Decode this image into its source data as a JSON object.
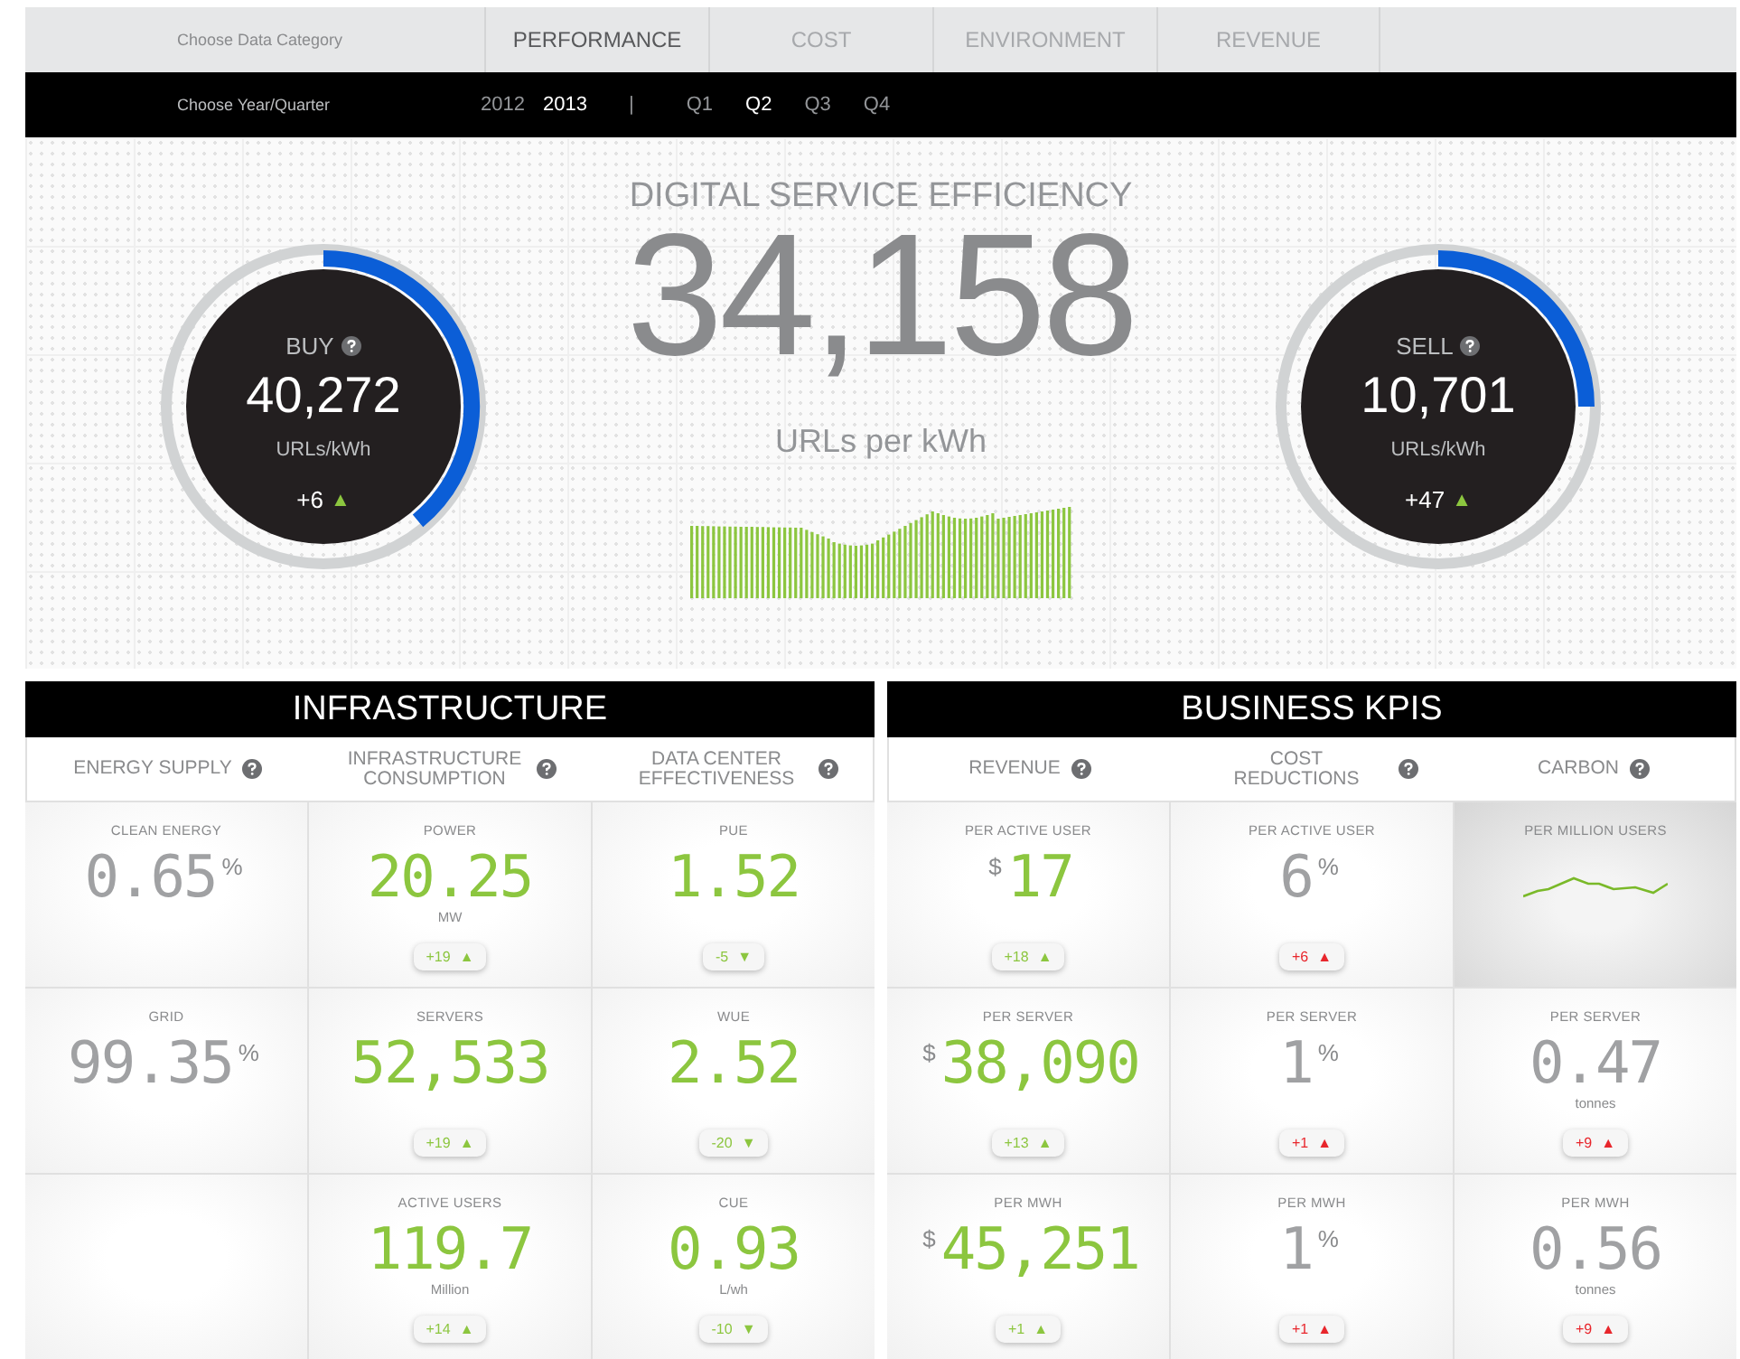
{
  "category_bar": {
    "label": "Choose Data Category",
    "tabs": [
      {
        "label": "PERFORMANCE",
        "selected": true
      },
      {
        "label": "COST",
        "selected": false
      },
      {
        "label": "ENVIRONMENT",
        "selected": false
      },
      {
        "label": "REVENUE",
        "selected": false
      }
    ]
  },
  "period_bar": {
    "label": "Choose Year/Quarter",
    "years": [
      {
        "label": "2012",
        "selected": false
      },
      {
        "label": "2013",
        "selected": true
      }
    ],
    "separator": "|",
    "quarters": [
      {
        "label": "Q1",
        "selected": false
      },
      {
        "label": "Q2",
        "selected": true
      },
      {
        "label": "Q3",
        "selected": false
      },
      {
        "label": "Q4",
        "selected": false
      }
    ]
  },
  "hero": {
    "title": "DIGITAL SERVICE EFFICIENCY",
    "value": "34,158",
    "chart_label": "URLs per kWh",
    "gauges": [
      {
        "label": "BUY",
        "value": "40,272",
        "unit": "URLs/kWh",
        "change": "+6",
        "arrow": "▲"
      },
      {
        "label": "SELL",
        "value": "10,701",
        "unit": "URLs/kWh",
        "change": "+47",
        "arrow": "▲"
      }
    ]
  },
  "panels": [
    {
      "title": "INFRASTRUCTURE",
      "columns": [
        {
          "label": "ENERGY SUPPLY"
        },
        {
          "label": "INFRASTRUCTURE CONSUMPTION"
        },
        {
          "label": "DATA CENTER EFFECTIVENESS"
        }
      ],
      "rows": [
        [
          {
            "kind": "metric",
            "label": "CLEAN ENERGY",
            "value": "0.65",
            "suffix": "%",
            "highlight": false
          },
          {
            "kind": "metric",
            "label": "POWER",
            "value": "20.25",
            "unit": "MW",
            "highlight": true,
            "change": {
              "text": "+19",
              "arrow": "▲",
              "favorable": true
            }
          },
          {
            "kind": "metric",
            "label": "PUE",
            "value": "1.52",
            "highlight": true,
            "change": {
              "text": "-5",
              "arrow": "▼",
              "favorable": true
            }
          }
        ],
        [
          {
            "kind": "metric",
            "label": "GRID",
            "value": "99.35",
            "suffix": "%",
            "highlight": false
          },
          {
            "kind": "metric",
            "label": "SERVERS",
            "value": "52,533",
            "highlight": true,
            "change": {
              "text": "+19",
              "arrow": "▲",
              "favorable": true
            }
          },
          {
            "kind": "metric",
            "label": "WUE",
            "value": "2.52",
            "highlight": true,
            "change": {
              "text": "-20",
              "arrow": "▼",
              "favorable": true
            }
          }
        ],
        [
          {
            "kind": "empty"
          },
          {
            "kind": "metric",
            "label": "ACTIVE USERS",
            "value": "119.7",
            "unit": "Million",
            "highlight": true,
            "change": {
              "text": "+14",
              "arrow": "▲",
              "favorable": true
            }
          },
          {
            "kind": "metric",
            "label": "CUE",
            "value": "0.93",
            "unit": "L/wh",
            "highlight": true,
            "change": {
              "text": "-10",
              "arrow": "▼",
              "favorable": true
            }
          }
        ]
      ]
    },
    {
      "title": "BUSINESS KPIS",
      "columns": [
        {
          "label": "REVENUE"
        },
        {
          "label": "COST REDUCTIONS"
        },
        {
          "label": "CARBON"
        }
      ],
      "rows": [
        [
          {
            "kind": "metric",
            "label": "PER ACTIVE USER",
            "prefix": "$",
            "value": "17",
            "highlight": true,
            "change": {
              "text": "+18",
              "arrow": "▲",
              "favorable": true
            }
          },
          {
            "kind": "metric",
            "label": "PER ACTIVE USER",
            "value": "6",
            "suffix": "%",
            "highlight": false,
            "change": {
              "text": "+6",
              "arrow": "▲",
              "favorable": false
            }
          },
          {
            "kind": "sparkline",
            "label": "PER MILLION USERS"
          }
        ],
        [
          {
            "kind": "metric",
            "label": "PER SERVER",
            "prefix": "$",
            "value": "38,090",
            "highlight": true,
            "change": {
              "text": "+13",
              "arrow": "▲",
              "favorable": true
            }
          },
          {
            "kind": "metric",
            "label": "PER SERVER",
            "value": "1",
            "suffix": "%",
            "highlight": false,
            "change": {
              "text": "+1",
              "arrow": "▲",
              "favorable": false
            }
          },
          {
            "kind": "metric",
            "label": "PER SERVER",
            "value": "0.47",
            "unit": "tonnes",
            "highlight": false,
            "change": {
              "text": "+9",
              "arrow": "▲",
              "favorable": false
            }
          }
        ],
        [
          {
            "kind": "metric",
            "label": "PER MWH",
            "prefix": "$",
            "value": "45,251",
            "highlight": true,
            "change": {
              "text": "+1",
              "arrow": "▲",
              "favorable": true
            }
          },
          {
            "kind": "metric",
            "label": "PER MWH",
            "value": "1",
            "suffix": "%",
            "highlight": false,
            "change": {
              "text": "+1",
              "arrow": "▲",
              "favorable": false
            }
          },
          {
            "kind": "metric",
            "label": "PER MWH",
            "value": "0.56",
            "unit": "tonnes",
            "highlight": false,
            "change": {
              "text": "+9",
              "arrow": "▲",
              "favorable": false
            }
          }
        ]
      ]
    }
  ]
}
